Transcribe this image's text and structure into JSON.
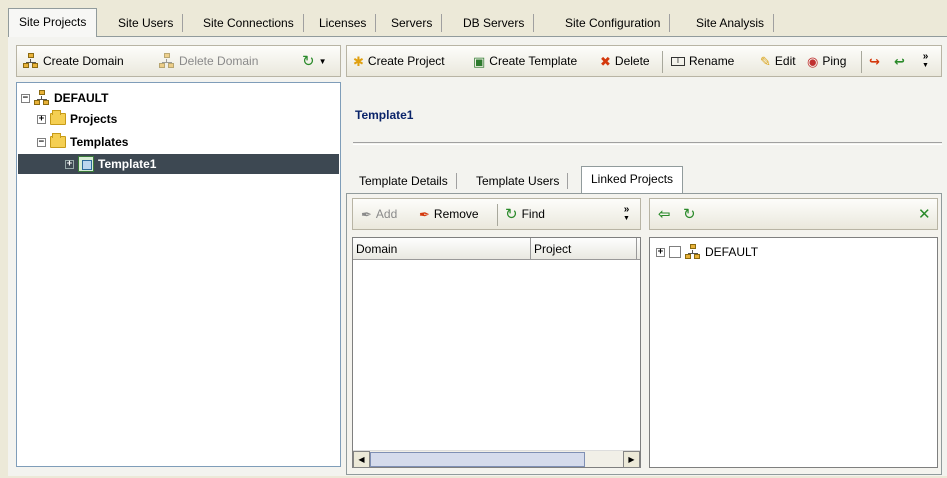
{
  "top_tabs": [
    {
      "label": "Site Projects",
      "active": true
    },
    {
      "label": "Site Users"
    },
    {
      "label": "Site Connections"
    },
    {
      "label": "Licenses"
    },
    {
      "label": "Servers"
    },
    {
      "label": "DB Servers"
    },
    {
      "label": "Site Configuration"
    },
    {
      "label": "Site Analysis"
    }
  ],
  "left_toolbar": {
    "create_domain": "Create Domain",
    "delete_domain": "Delete Domain"
  },
  "right_toolbar": {
    "create_project": "Create Project",
    "create_template": "Create Template",
    "delete": "Delete",
    "rename": "Rename",
    "edit": "Edit",
    "ping": "Ping"
  },
  "tree": {
    "root": "DEFAULT",
    "projects": "Projects",
    "templates": "Templates",
    "selected": "Template1"
  },
  "detail": {
    "title": "Template1",
    "tabs": [
      "Template Details",
      "Template Users",
      "Linked Projects"
    ],
    "active_tab": "Linked Projects"
  },
  "linked": {
    "add": "Add",
    "remove": "Remove",
    "find": "Find",
    "columns": [
      "Domain",
      "Project"
    ],
    "available_tree_root": "DEFAULT"
  },
  "colors": {
    "title_blue": "#0a246a",
    "selection": "#3d4852",
    "delete_red": "#d4380c",
    "green": "#2a8a2a"
  },
  "icons": {
    "refresh": "refresh-icon",
    "more": "more-chevron-icon",
    "back": "arrow-left-icon",
    "close": "close-icon"
  }
}
